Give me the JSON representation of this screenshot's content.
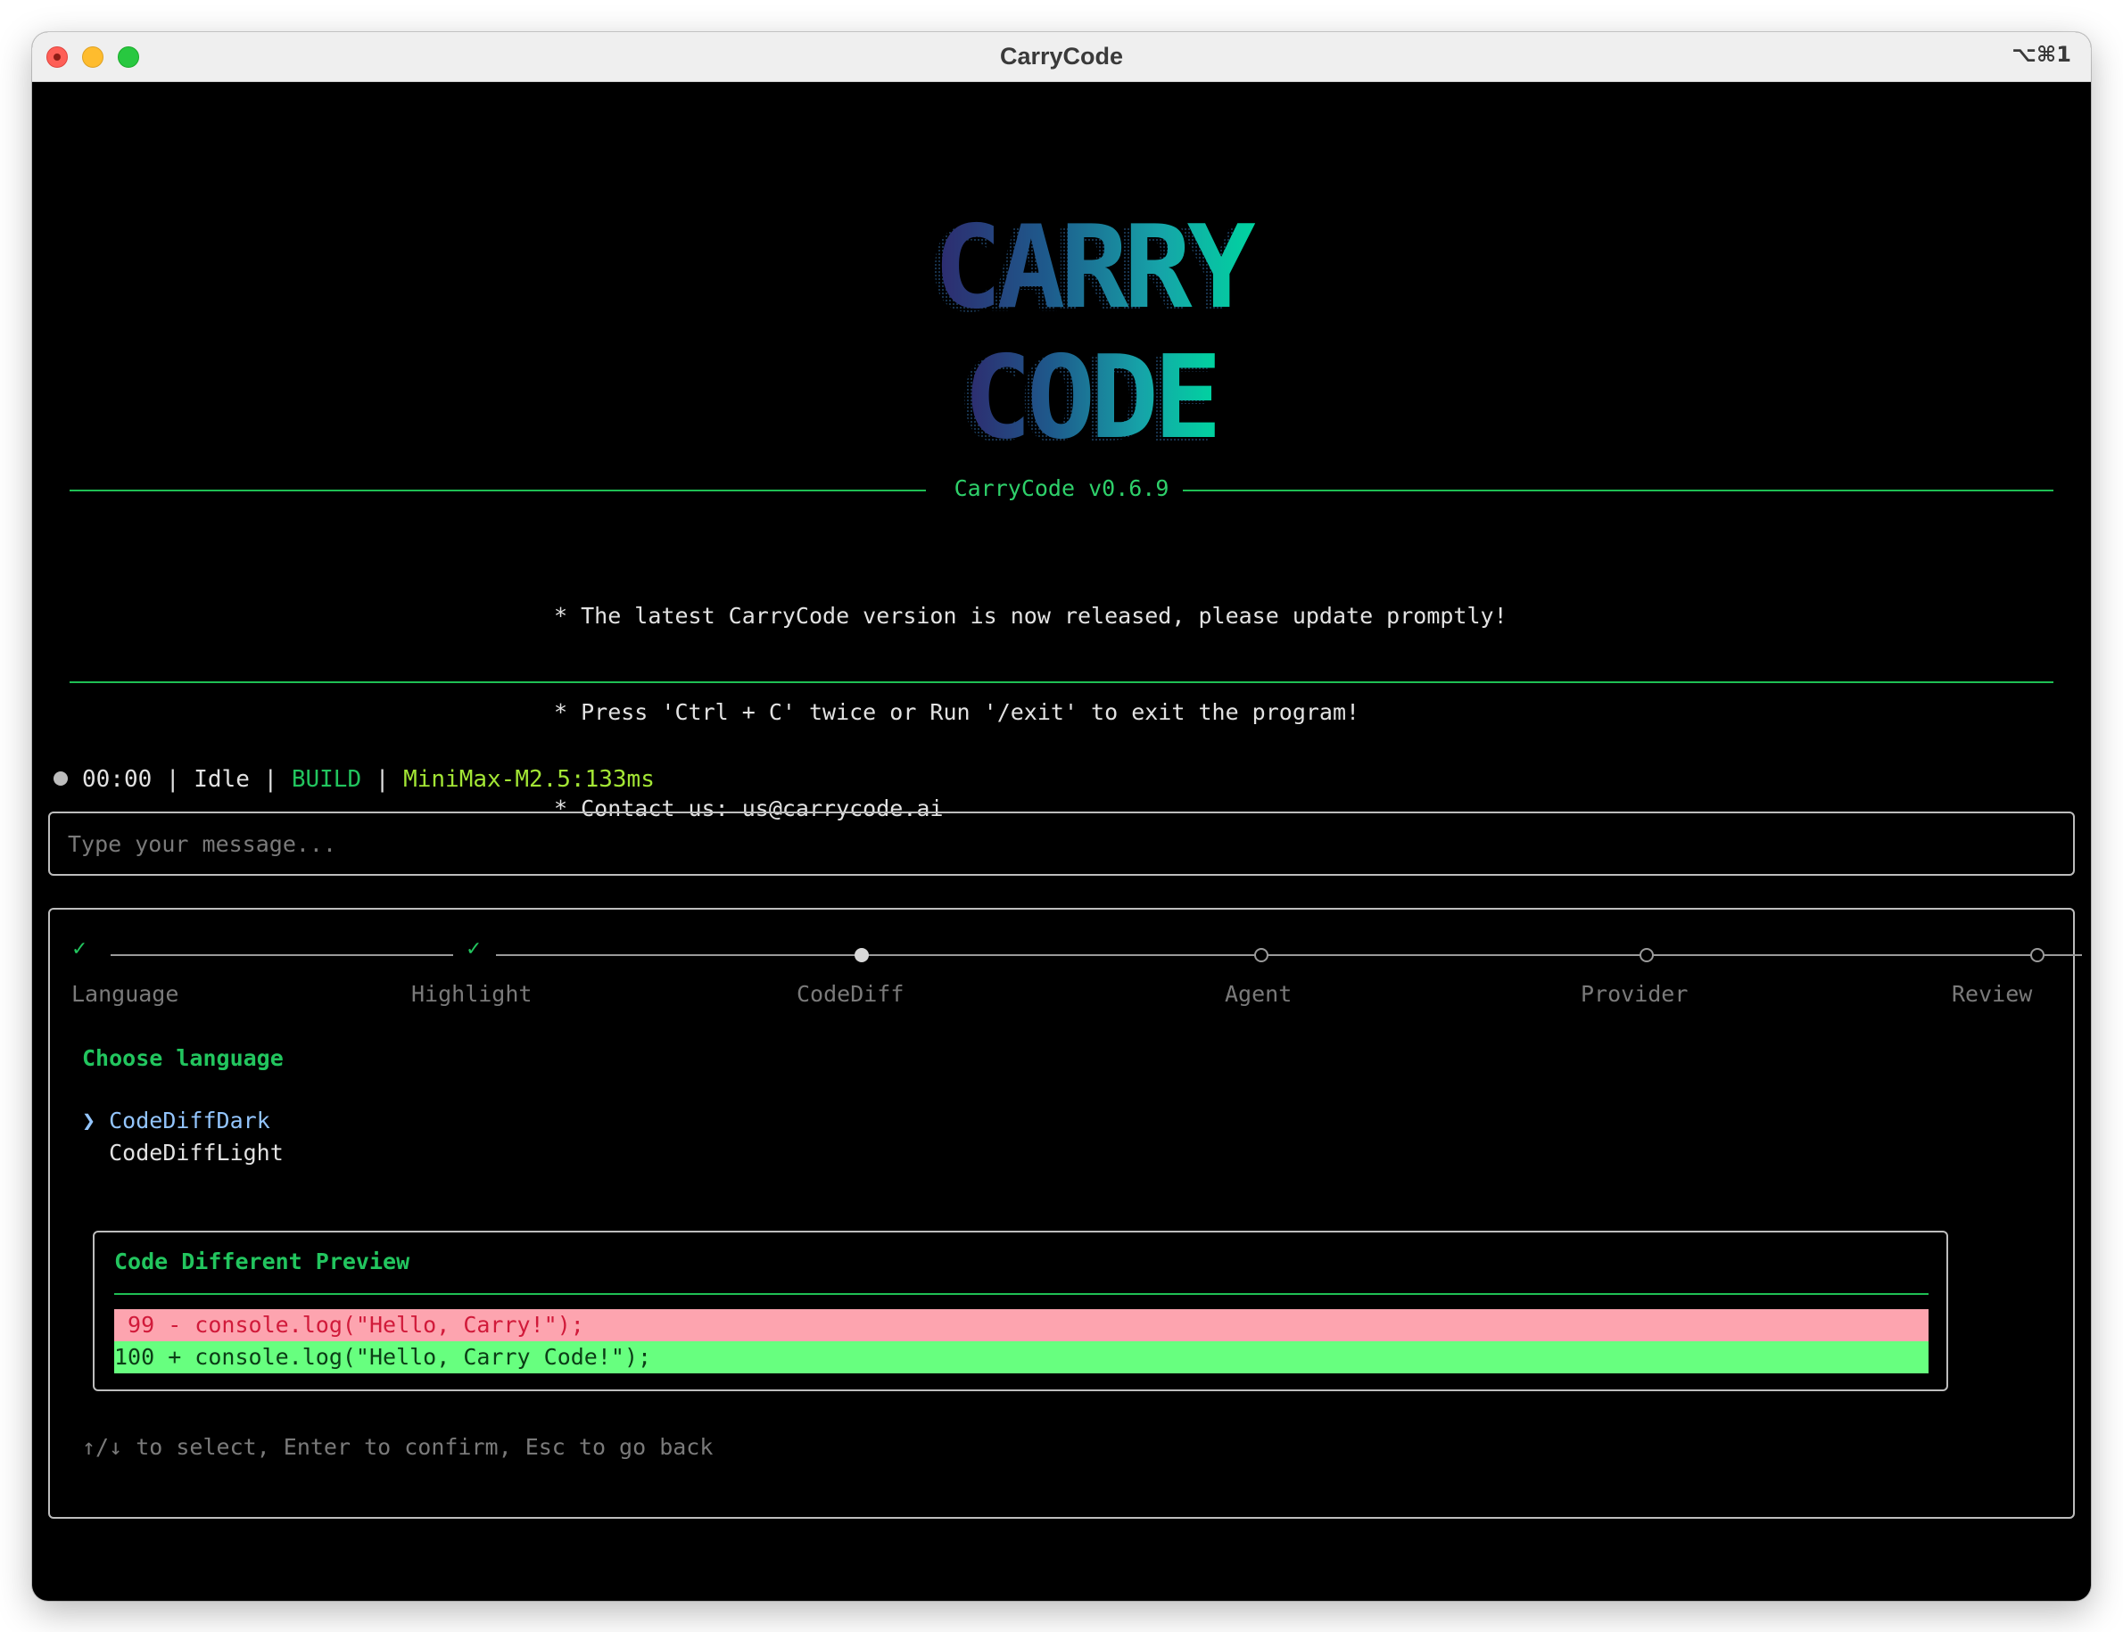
{
  "window": {
    "title": "CarryCode",
    "shortcut": "⌥⌘1"
  },
  "banner": {
    "logo_lines": [
      "CARRY",
      "CODE"
    ],
    "logo_gradient": [
      "#2e2a6e",
      "#1e5a8c",
      "#16a3a8",
      "#00d4a0"
    ],
    "version": "CarryCode v0.6.9",
    "notices": [
      "* The latest CarryCode version is now released, please update promptly!",
      "* Press 'Ctrl + C' twice or Run '/exit' to exit the program!",
      "* Contact us: us@carrycode.ai"
    ]
  },
  "status": {
    "time": "00:00",
    "state": "Idle",
    "mode": "BUILD",
    "model": "MiniMax-M2.5:133ms",
    "sep": " | "
  },
  "input": {
    "placeholder": "Type your message...",
    "value": ""
  },
  "wizard": {
    "steps": [
      {
        "label": "Language",
        "status": "done"
      },
      {
        "label": "Highlight",
        "status": "done"
      },
      {
        "label": "CodeDiff",
        "status": "current"
      },
      {
        "label": "Agent",
        "status": "pending"
      },
      {
        "label": "Provider",
        "status": "pending"
      },
      {
        "label": "Review",
        "status": "pending"
      }
    ],
    "check_glyph": "✓",
    "heading": "Choose language",
    "options": [
      {
        "label": "CodeDiffDark",
        "selected": true
      },
      {
        "label": "CodeDiffLight",
        "selected": false
      }
    ],
    "caret": "❯",
    "preview": {
      "title": "Code Different Preview",
      "removed": " 99 - console.log(\"Hello, Carry!\");",
      "added": "100 + console.log(\"Hello, Carry Code!\");"
    },
    "hint": "↑/↓ to select, Enter to confirm, Esc to go back"
  },
  "colors": {
    "accent_green": "#22c55e",
    "selected_blue": "#93c5fd",
    "model_lime": "#a3e635",
    "diff_removed_bg": "#fda4af",
    "diff_added_bg": "#67ff7f"
  }
}
